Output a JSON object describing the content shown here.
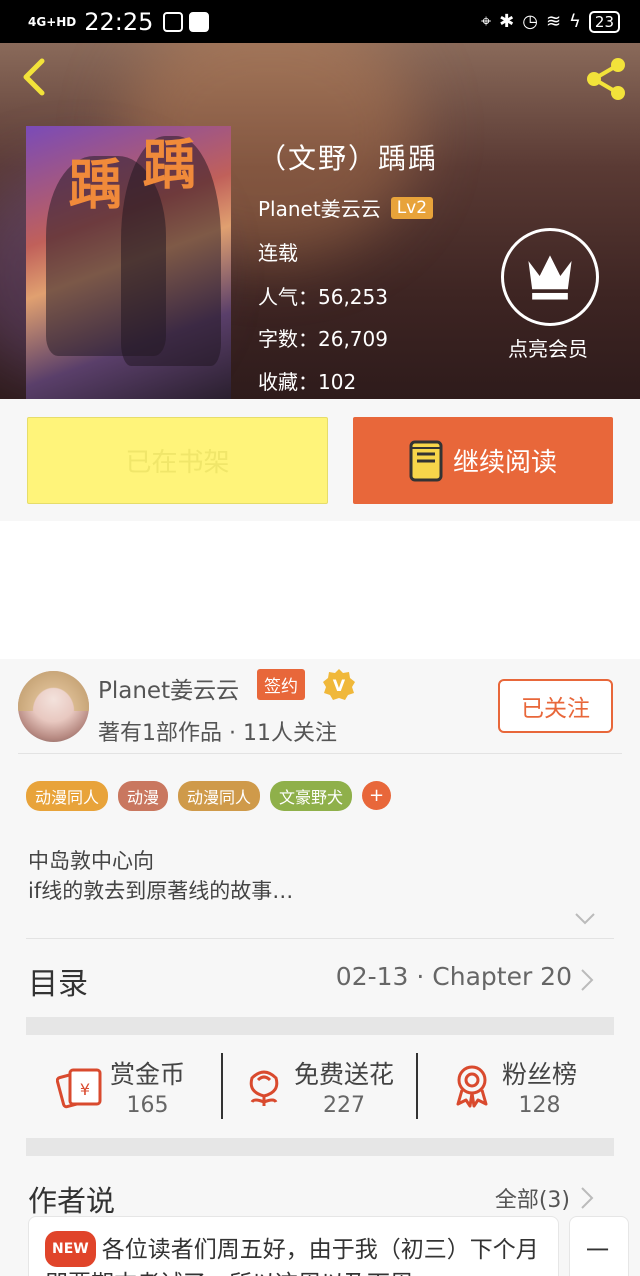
{
  "status_bar": {
    "network": "4G+HD",
    "time": "22:25",
    "battery": "23"
  },
  "book": {
    "title": "（文野）踽踽",
    "cover_title_1": "踽",
    "cover_title_2": "踽",
    "author": "Planet姜云云",
    "level": "Lv2",
    "status": "连载",
    "popularity": "人气：56,253",
    "word_count": "字数：26,709",
    "favorites": "收藏：102"
  },
  "vip": {
    "label": "点亮会员"
  },
  "actions": {
    "shelf_label": "已在书架",
    "read_label": "继续阅读"
  },
  "author_card": {
    "name": "Planet姜云云",
    "sign_badge": "签约",
    "v_badge": "V",
    "summary": "著有1部作品 · 11人关注",
    "follow_label": "已关注"
  },
  "tags": [
    {
      "label": "动漫同人",
      "color": "#e8a33a"
    },
    {
      "label": "动漫",
      "color": "#c9775f"
    },
    {
      "label": "动漫同人",
      "color": "#cf9a4a"
    },
    {
      "label": "文豪野犬",
      "color": "#8fb04a"
    }
  ],
  "tag_add": "+",
  "description": {
    "line1": "中岛敦中心向",
    "line2": "if线的敦去到原著线的故事…"
  },
  "catalog": {
    "title": "目录",
    "latest": "02-13 · Chapter 20"
  },
  "stats": [
    {
      "label": "赏金币",
      "value": "165",
      "icon": "red-envelope-icon"
    },
    {
      "label": "免费送花",
      "value": "227",
      "icon": "flower-icon"
    },
    {
      "label": "粉丝榜",
      "value": "128",
      "icon": "medal-icon"
    }
  ],
  "author_says": {
    "title": "作者说",
    "all_label": "全部(3)",
    "new_badge": "NEW",
    "text": "各位读者们周五好，由于我（初三）下个月即要期末考试了，所以这周以及下周",
    "card2_text": "一"
  },
  "colors": {
    "accent": "#e8673a",
    "shelf_yellow": "#fff47a",
    "level_badge": "#e8a33a"
  }
}
